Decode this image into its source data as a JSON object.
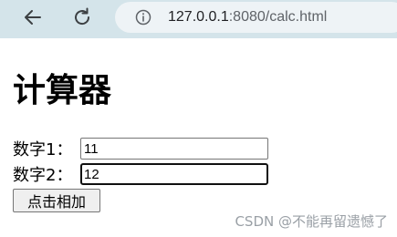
{
  "browser": {
    "url_host": "127.0.0.1",
    "url_rest": ":8080/calc.html",
    "back_icon": "arrow-left-icon",
    "reload_icon": "reload-icon",
    "info_icon": "info-icon"
  },
  "page": {
    "title": "计算器",
    "fields": [
      {
        "label": "数字1：",
        "value": "11"
      },
      {
        "label": "数字2：",
        "value": "12"
      }
    ],
    "button_label": "点击相加"
  },
  "watermark": "CSDN @不能再留遗憾了"
}
